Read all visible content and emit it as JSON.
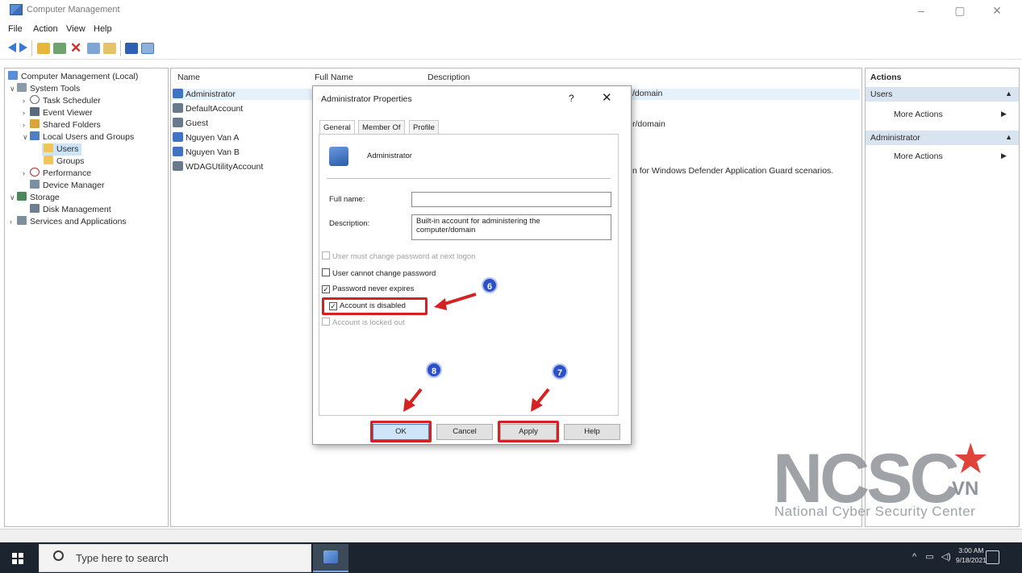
{
  "window": {
    "title": "Computer Management",
    "minimize_glyph": "–",
    "maximize_glyph": "▢",
    "close_glyph": "✕"
  },
  "menu": [
    "File",
    "Action",
    "View",
    "Help"
  ],
  "tree": {
    "root": "Computer Management (Local)",
    "system_tools": "System Tools",
    "task_scheduler": "Task Scheduler",
    "event_viewer": "Event Viewer",
    "shared_folders": "Shared Folders",
    "local_users_groups": "Local Users and Groups",
    "users": "Users",
    "groups": "Groups",
    "performance": "Performance",
    "device_manager": "Device Manager",
    "storage": "Storage",
    "disk_management": "Disk Management",
    "services_apps": "Services and Applications"
  },
  "list": {
    "columns": [
      "Name",
      "Full Name",
      "Description"
    ],
    "rows": [
      {
        "name": "Administrator",
        "description": "/domain"
      },
      {
        "name": "DefaultAccount",
        "description": ""
      },
      {
        "name": "Guest",
        "description": "r/domain"
      },
      {
        "name": "Nguyen Van A",
        "description": ""
      },
      {
        "name": "Nguyen Van B",
        "description": ""
      },
      {
        "name": "WDAGUtilityAccount",
        "description": "n for Windows Defender Application Guard scenarios."
      }
    ]
  },
  "actions": {
    "title": "Actions",
    "users_header": "Users",
    "users_more": "More Actions",
    "admin_header": "Administrator",
    "admin_more": "More Actions"
  },
  "dialog": {
    "title": "Administrator Properties",
    "help_glyph": "?",
    "close_glyph": "✕",
    "tabs": [
      "General",
      "Member Of",
      "Profile"
    ],
    "user_name": "Administrator",
    "full_name_label": "Full name:",
    "full_name_value": "",
    "description_label": "Description:",
    "description_value": "Built-in account for administering the computer/domain",
    "checkboxes": [
      {
        "label": "User must change password at next logon",
        "checked": false,
        "enabled": false
      },
      {
        "label": "User cannot change password",
        "checked": false,
        "enabled": true
      },
      {
        "label": "Password never expires",
        "checked": true,
        "enabled": true
      },
      {
        "label": "Account is disabled",
        "checked": true,
        "enabled": true
      },
      {
        "label": "Account is locked out",
        "checked": false,
        "enabled": false
      }
    ],
    "buttons": {
      "ok": "OK",
      "cancel": "Cancel",
      "apply": "Apply",
      "help": "Help"
    }
  },
  "annotations": {
    "step6": "6",
    "step7": "7",
    "step8": "8",
    "highlight_color": "#d42222",
    "badge_color": "#2b50c9"
  },
  "taskbar": {
    "search_placeholder": "Type here to search",
    "time": "3:00 AM",
    "date": "9/18/2021"
  },
  "watermark": {
    "logo": "NCSC",
    "country": "VN",
    "subtitle": "National Cyber Security Center"
  }
}
